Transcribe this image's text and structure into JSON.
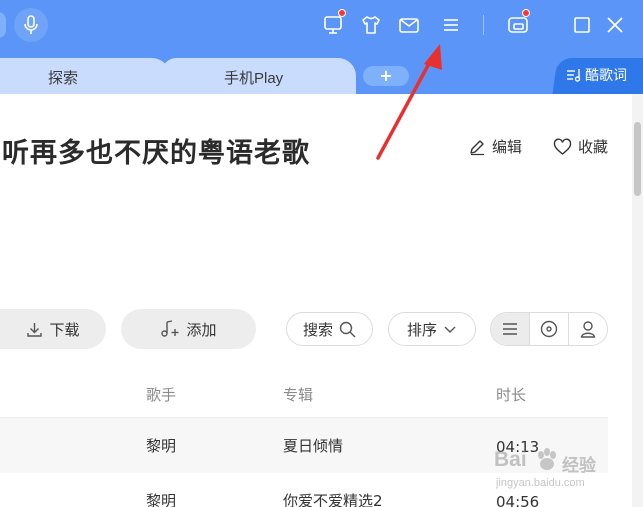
{
  "titlebar": {
    "background": "#5b95f7",
    "icons": [
      "microphone-icon",
      "monitor-icon",
      "tshirt-icon",
      "mail-icon",
      "menu-icon",
      "mini-player-icon",
      "maximize-icon",
      "close-icon"
    ]
  },
  "tabs": {
    "items": [
      {
        "label": "探索",
        "active": false
      },
      {
        "label": "手机Play",
        "active": false
      }
    ],
    "add_label": "+",
    "lyrics_label": "酷歌词"
  },
  "playlist": {
    "title": "听再多也不厌的粤语老歌",
    "edit_label": "编辑",
    "favorite_label": "收藏"
  },
  "toolbar": {
    "download_label": "下载",
    "add_label": "添加",
    "search_label": "搜索",
    "sort_label": "排序"
  },
  "table": {
    "columns": {
      "artist": "歌手",
      "album": "专辑",
      "duration": "时长"
    },
    "rows": [
      {
        "artist": "黎明",
        "album": "夏日倾情",
        "duration": "04:13"
      },
      {
        "artist": "黎明",
        "album": "你爱不爱精选2",
        "duration": "04:56"
      }
    ]
  },
  "watermark": {
    "brand": "Bai",
    "brand_suffix": "经验",
    "url": "jingyan.baidu.com"
  },
  "colors": {
    "accent": "#5b95f7",
    "lyrics_tab": "#2f78ea",
    "notification": "#f23a3a",
    "annotation_arrow": "#e8312f"
  }
}
